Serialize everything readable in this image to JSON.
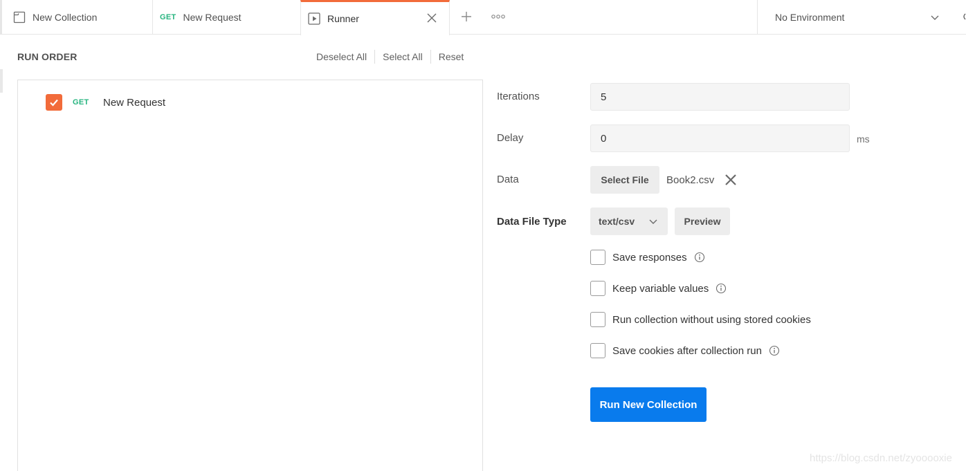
{
  "tabs": {
    "collection": {
      "label": "New Collection",
      "icon": "collection-icon"
    },
    "request": {
      "method": "GET",
      "label": "New Request"
    },
    "runner": {
      "label": "Runner",
      "icon": "play-icon",
      "active_color": "#f26b3a"
    }
  },
  "environment": {
    "selected": "No Environment"
  },
  "run_order": {
    "title": "RUN ORDER",
    "deselect_all": "Deselect All",
    "select_all": "Select All",
    "reset": "Reset",
    "requests": [
      {
        "method": "GET",
        "name": "New Request",
        "checked": true
      }
    ]
  },
  "settings": {
    "iterations_label": "Iterations",
    "iterations_value": "5",
    "delay_label": "Delay",
    "delay_value": "0",
    "delay_unit": "ms",
    "data_label": "Data",
    "select_file_label": "Select File",
    "file_name": "Book2.csv",
    "data_file_type_label": "Data File Type",
    "data_file_type_value": "text/csv",
    "preview_label": "Preview",
    "options": [
      {
        "label": "Save responses",
        "checked": false,
        "info": true
      },
      {
        "label": "Keep variable values",
        "checked": false,
        "info": true
      },
      {
        "label": "Run collection without using stored cookies",
        "checked": false,
        "info": false
      },
      {
        "label": "Save cookies after collection run",
        "checked": false,
        "info": true
      }
    ],
    "run_button_label": "Run New Collection"
  },
  "colors": {
    "accent_orange": "#f26b3a",
    "method_get": "#26b47f",
    "run_button": "#097bed"
  },
  "watermark": "https://blog.csdn.net/zyooooxie"
}
